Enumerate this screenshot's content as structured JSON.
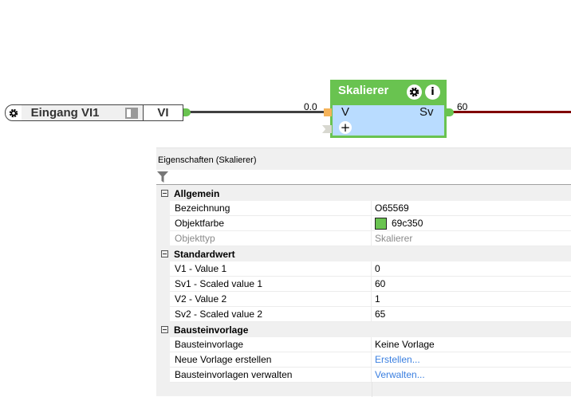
{
  "canvas": {
    "input_node": {
      "title": "Eingang VI1",
      "output_label": "VI",
      "icon": "gear-icon"
    },
    "scaler_node": {
      "title": "Skalierer",
      "input_label": "V",
      "output_label": "Sv",
      "color": "#69c350",
      "icons": [
        "gear-icon",
        "info-icon",
        "plus-icon"
      ]
    },
    "wire_in_value": "0.0",
    "wire_out_value": "60",
    "colors": {
      "wire_in": "#404040",
      "wire_out": "#800000",
      "port_in": "#f5b35a",
      "body": "#b9dcff"
    }
  },
  "properties": {
    "title": "Eigenschaften (Skalierer)",
    "filter_icon": "filter-icon",
    "rows": [
      {
        "type": "cat",
        "label": "Allgemein"
      },
      {
        "type": "prop",
        "label": "Bezeichnung",
        "value": "O65569"
      },
      {
        "type": "prop",
        "label": "Objektfarbe",
        "value": "69c350",
        "swatch": "#69c350"
      },
      {
        "type": "prop",
        "label": "Objekttyp",
        "value": "Skalierer",
        "disabled": true
      },
      {
        "type": "cat",
        "label": "Standardwert"
      },
      {
        "type": "prop",
        "label": "V1 - Value 1",
        "value": "0"
      },
      {
        "type": "prop",
        "label": "Sv1 - Scaled value 1",
        "value": "60"
      },
      {
        "type": "prop",
        "label": "V2 - Value 2",
        "value": "1"
      },
      {
        "type": "prop",
        "label": "Sv2 - Scaled value 2",
        "value": "65"
      },
      {
        "type": "cat",
        "label": "Bausteinvorlage"
      },
      {
        "type": "prop",
        "label": "Bausteinvorlage",
        "value": "Keine Vorlage"
      },
      {
        "type": "prop",
        "label": "Neue Vorlage erstellen",
        "value": "Erstellen...",
        "link": true
      },
      {
        "type": "prop",
        "label": "Bausteinvorlagen verwalten",
        "value": "Verwalten...",
        "link": true
      }
    ]
  }
}
